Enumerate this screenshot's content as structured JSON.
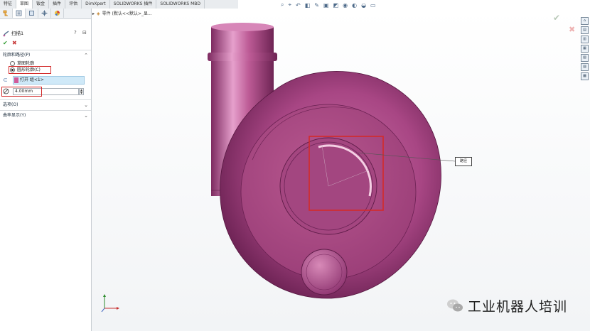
{
  "tabs": [
    "特征",
    "草图",
    "钣金",
    "插件",
    "评估",
    "DimXpert",
    "SOLIDWORKS 插件",
    "SOLIDWORKS MBD"
  ],
  "active_tab_index": 1,
  "property_manager": {
    "icon_names": [
      "feature-manager-icon",
      "property-manager-icon",
      "configuration-icon",
      "dimxpert-icon",
      "display-manager-icon"
    ],
    "title": "扫描1",
    "help_icon": "?",
    "pin_icon": "⊟",
    "ok_icon": "✔",
    "cancel_icon": "✖",
    "section_profile": "轮廓和路径(P)",
    "radio_sketch_profile": "草图轮廓",
    "radio_circular_profile": "圆形轮廓(C)",
    "selection_value": "打开 组<1>",
    "diameter_value": "4.00mm",
    "section_options": "选项(O)",
    "section_curvature": "曲率显示(Y)"
  },
  "viewport": {
    "tree_flyout": "零件 (默认<<默认>_显...",
    "callout_label": "路径"
  },
  "watermark": "工业机器人培训",
  "colors": {
    "part_main": "#b0508a",
    "part_highlight": "#e9a2cf",
    "part_shadow": "#6a2152",
    "selection_red": "#d32a2a",
    "selection_blue": "#cfe9f8"
  }
}
